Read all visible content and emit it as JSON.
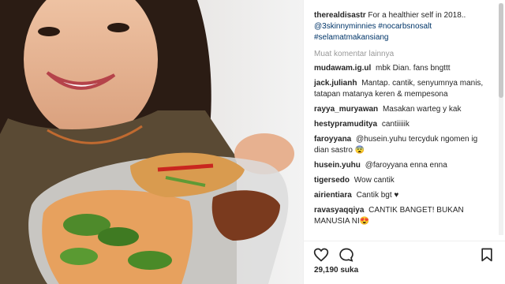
{
  "photo": {
    "alt_icon": "photo-woman-food-container"
  },
  "post": {
    "author": "therealdisastr",
    "caption_text": "For a healthier self in 2018..",
    "hashtags": [
      "@3skinnyminnies",
      "#nocarbsnosalt",
      "#selamatmakansiang"
    ],
    "load_more": "Muat komentar lainnya"
  },
  "comments": [
    {
      "user": "mudawam.ig.ul",
      "text": "mbk Dian. fans bngttt"
    },
    {
      "user": "jack.julianh",
      "text": "Mantap. cantik, senyumnya manis, tatapan matanya keren & mempesona"
    },
    {
      "user": "rayya_muryawan",
      "text": "Masakan warteg y kak"
    },
    {
      "user": "hestypramuditya",
      "text": "cantiiiiik"
    },
    {
      "user": "faroyyana",
      "text": "@husein.yuhu tercyduk ngomen ig dian sastro 😨"
    },
    {
      "user": "husein.yuhu",
      "text": "@faroyyana enna enna"
    },
    {
      "user": "tigersedo",
      "text": "Wow cantik"
    },
    {
      "user": "airientiara",
      "text": "Cantik bgt ♥"
    },
    {
      "user": "ravasyaqqiya",
      "text": "CANTIK BANGET! BUKAN MANUSIA NI😍"
    }
  ],
  "actions": {
    "like_icon": "heart-outline-icon",
    "comment_icon": "comment-bubble-icon",
    "save_icon": "bookmark-icon"
  },
  "likes": {
    "label": "29,190 suka"
  },
  "colors": {
    "text": "#262626",
    "hashtag": "#003569",
    "muted": "#999999"
  }
}
